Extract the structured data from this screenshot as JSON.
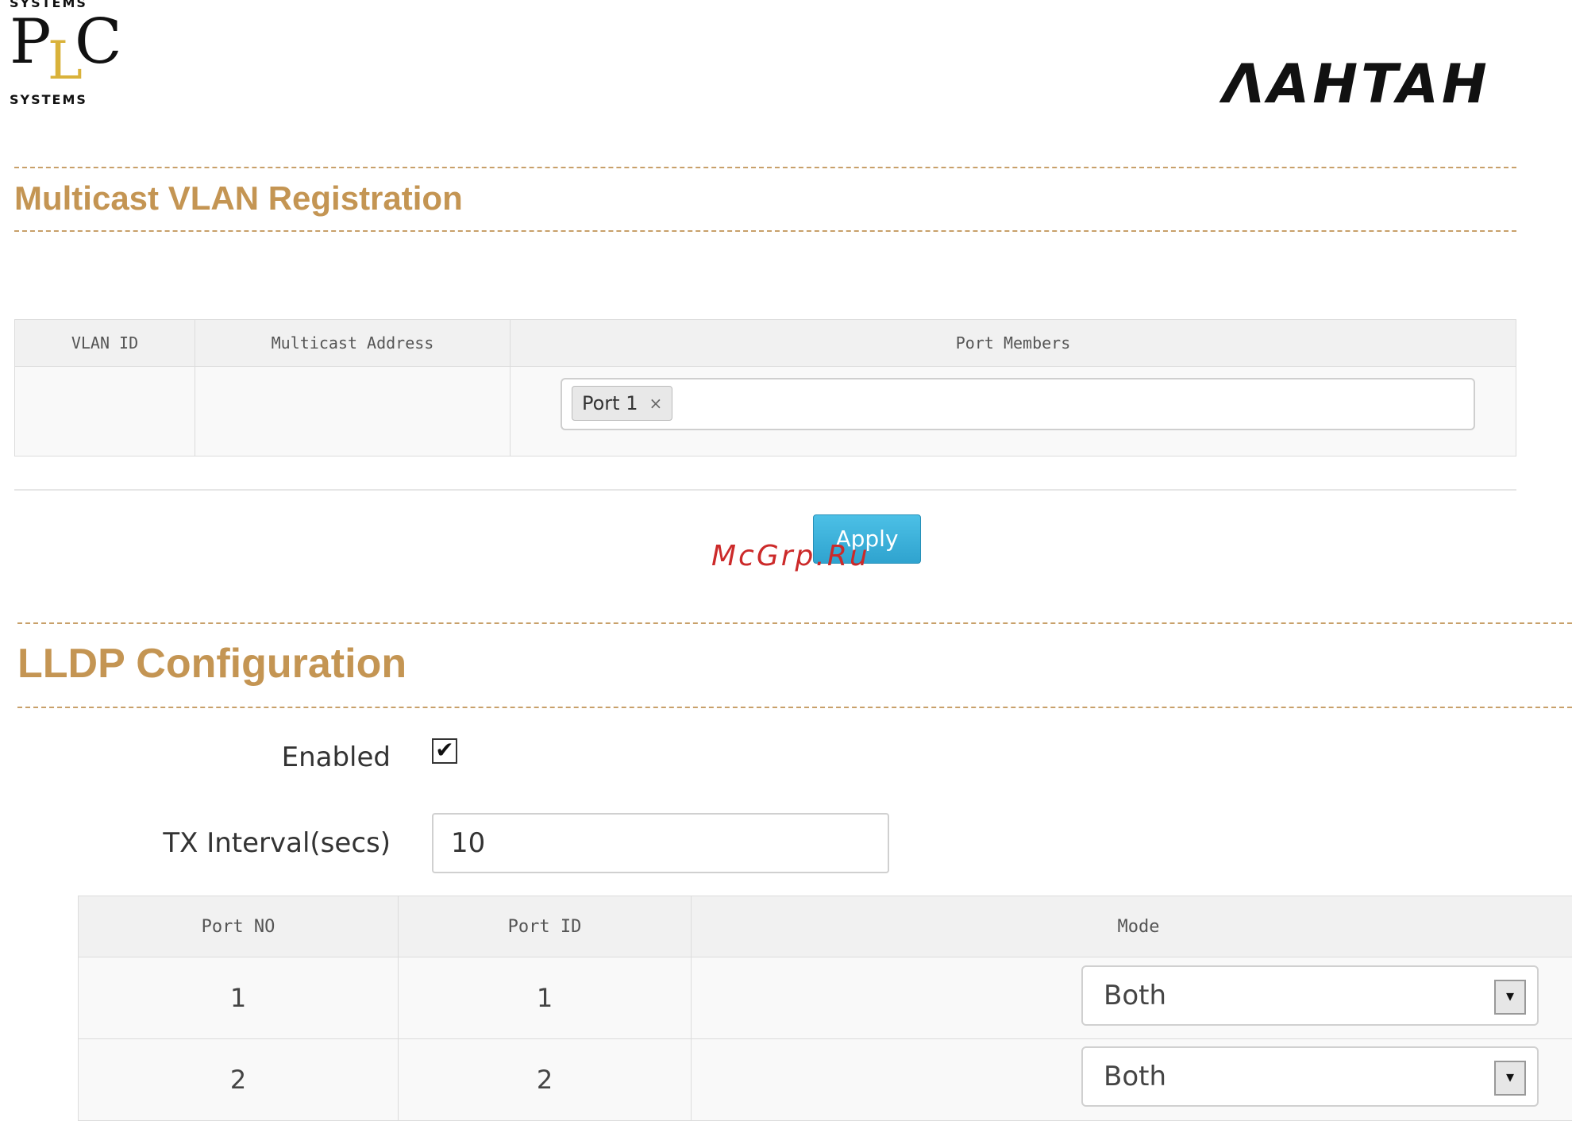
{
  "logos": {
    "plc": {
      "top_text": "SYSTEMS",
      "letters": [
        "P",
        "L",
        "C"
      ],
      "bottom_text": "SYSTEMS"
    },
    "brand": "ΛAHTAH"
  },
  "mvr": {
    "title": "Multicast VLAN Registration",
    "columns": [
      "VLAN ID",
      "Multicast Address",
      "Port Members"
    ],
    "row": {
      "vlan_id": "",
      "multicast_address": "",
      "port_members": [
        "Port 1"
      ]
    },
    "chip_remove": "×",
    "apply_label": "Apply"
  },
  "watermark": "McGrp.Ru",
  "lldp": {
    "title": "LLDP Configuration",
    "enabled_label": "Enabled",
    "enabled_checked": true,
    "check_glyph": "✔",
    "tx_label": "TX Interval(secs)",
    "tx_value": "10",
    "columns": [
      "Port NO",
      "Port ID",
      "Mode"
    ],
    "rows": [
      {
        "port_no": "1",
        "port_id": "1",
        "mode": "Both"
      },
      {
        "port_no": "2",
        "port_id": "2",
        "mode": "Both"
      }
    ],
    "select_arrow": "▾"
  },
  "colors": {
    "accent": "#c49553",
    "apply_button": "#2fa3cf",
    "watermark": "#cc2a2a",
    "logo_gold": "#d9b23a"
  }
}
